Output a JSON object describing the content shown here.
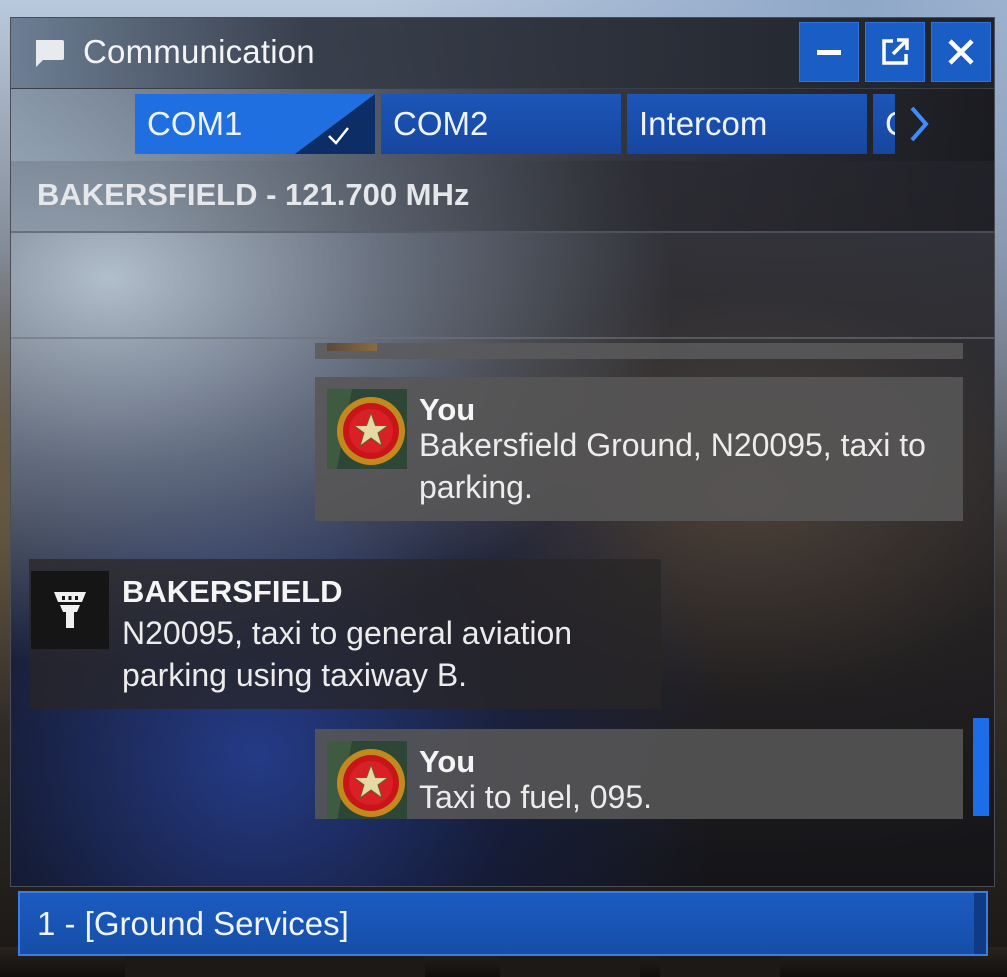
{
  "window": {
    "title": "Communication",
    "title_icon": "chat-bubble-icon",
    "buttons": [
      {
        "name": "minimize",
        "icon": "minus-icon"
      },
      {
        "name": "pop-out",
        "icon": "external-link-icon"
      },
      {
        "name": "close",
        "icon": "close-icon"
      }
    ]
  },
  "tabs": [
    {
      "label": "COM1",
      "active": true
    },
    {
      "label": "COM2",
      "active": false
    },
    {
      "label": "Intercom",
      "active": false
    },
    {
      "label": "C",
      "active": false
    }
  ],
  "frequency": {
    "label": "BAKERSFIELD - 121.700 MHz"
  },
  "messages": [
    {
      "sender": "You",
      "text": "Bakersfield Ground, N20095, taxi to parking.",
      "avatar": "pilot-badge-icon"
    },
    {
      "sender": "BAKERSFIELD",
      "text": "N20095, taxi to general aviation parking using taxiway B.",
      "avatar": "control-tower-icon"
    },
    {
      "sender": "You",
      "text": "Taxi to fuel, 095.",
      "avatar": "pilot-badge-icon"
    }
  ],
  "input": {
    "value": "1 - [Ground Services]"
  },
  "colors": {
    "accent": "#1d6ee6",
    "tab": "#1746a0",
    "tab_active": "#1f6fe0"
  }
}
